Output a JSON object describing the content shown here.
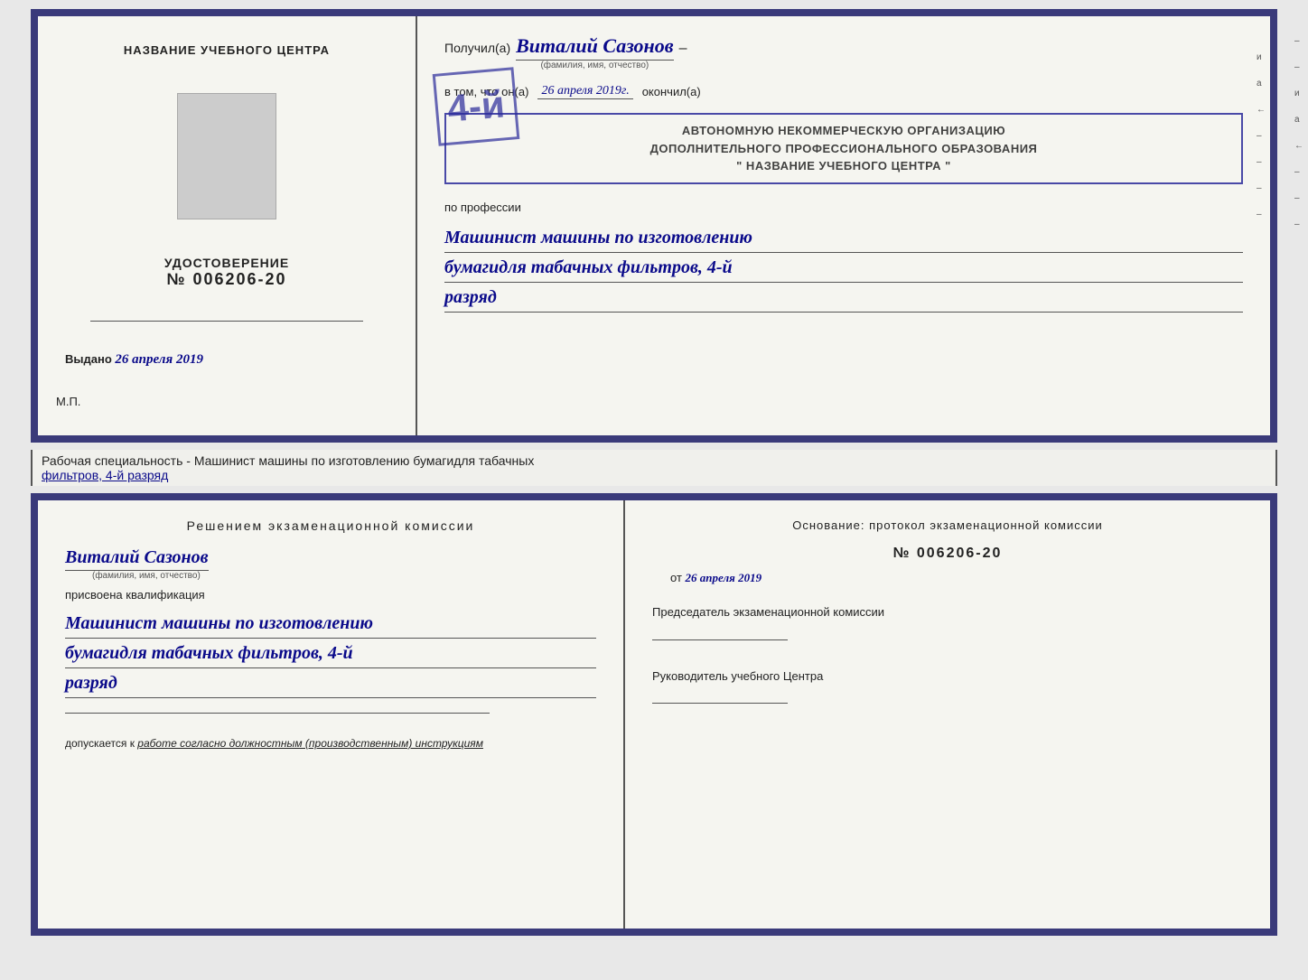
{
  "top_cert": {
    "left": {
      "title": "НАЗВАНИЕ УЧЕБНОГО ЦЕНТРА",
      "udostoverenie_label": "УДОСТОВЕРЕНИЕ",
      "number": "№ 006206-20",
      "vydano_label": "Выдано",
      "vydano_date": "26 апреля 2019",
      "mp_label": "М.П."
    },
    "right": {
      "poluchil_label": "Получил(а)",
      "name": "Виталий Сазонов",
      "name_sublabel": "(фамилия, имя, отчество)",
      "dash": "–",
      "vtom_label": "в том, что он(а)",
      "date_val": "26 апреля 2019г.",
      "okonchil_label": "окончил(а)",
      "stamp_text": "4-й",
      "org_line1": "АВТОНОМНУЮ НЕКОММЕРЧЕСКУЮ ОРГАНИЗАЦИЮ",
      "org_line2": "ДОПОЛНИТЕЛЬНОГО ПРОФЕССИОНАЛЬНОГО ОБРАЗОВАНИЯ",
      "org_line3": "\" НАЗВАНИЕ УЧЕБНОГО ЦЕНТРА \"",
      "po_professii": "по профессии",
      "profession_line1": "Машинист машины по изготовлению",
      "profession_line2": "бумагидля табачных фильтров, 4-й",
      "profession_line3": "разряд",
      "right_marks": [
        "и",
        "а",
        "←",
        "–",
        "–",
        "–",
        "–"
      ]
    }
  },
  "middle": {
    "text": "Рабочая специальность - Машинист машины по изготовлению бумагидля табачных",
    "text2_underlined": "фильтров, 4-й разряд"
  },
  "bottom_cert": {
    "left": {
      "decision_title": "Решением экзаменационной комиссии",
      "name": "Виталий Сазонов",
      "name_sublabel": "(фамилия, имя, отчество)",
      "prisvoen_label": "присвоена квалификация",
      "qualification_line1": "Машинист машины по изготовлению",
      "qualification_line2": "бумагидля табачных фильтров, 4-й",
      "qualification_line3": "разряд",
      "dopusk_prefix": "допускается к",
      "dopusk_italic": "работе согласно должностным (производственным) инструкциям"
    },
    "right": {
      "osnov_label": "Основание: протокол экзаменационной комиссии",
      "protocol_number": "№ 006206-20",
      "ot_label": "от",
      "ot_date": "26 апреля 2019",
      "chairman_label": "Председатель экзаменационной комиссии",
      "head_label": "Руководитель учебного Центра",
      "right_marks": [
        "–",
        "–",
        "и",
        "а",
        "←",
        "–",
        "–",
        "–"
      ]
    }
  }
}
